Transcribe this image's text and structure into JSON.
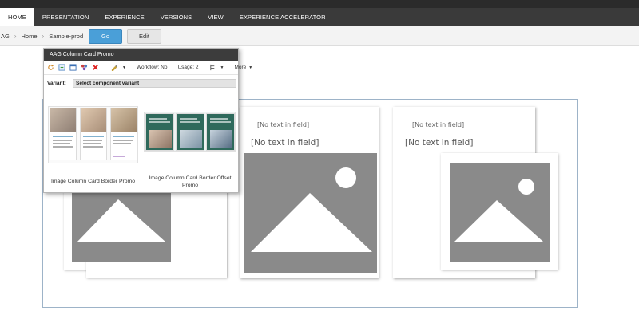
{
  "ribbon": {
    "tabs": [
      {
        "label": "HOME",
        "active": true
      },
      {
        "label": "PRESENTATION"
      },
      {
        "label": "EXPERIENCE"
      },
      {
        "label": "VERSIONS"
      },
      {
        "label": "VIEW"
      },
      {
        "label": "EXPERIENCE ACCELERATOR"
      }
    ]
  },
  "breadcrumb": {
    "items": [
      "AG",
      "Home",
      "Sample-prod"
    ],
    "go_label": "Go",
    "edit_label": "Edit"
  },
  "panel": {
    "title": "AAG Column Card Promo",
    "workflow": "Workflow: No",
    "usage": "Usage: 2",
    "more": "More",
    "variant_label": "Variant:",
    "variant_value": "Select component variant",
    "variants": [
      {
        "caption": "Image Column Card Border Promo"
      },
      {
        "caption": "Image Column Card Border Offset Promo"
      }
    ]
  },
  "stage": {
    "placeholder_small": "[No text in field]",
    "placeholder_large": "[No text in field]"
  },
  "colors": {
    "ribbon_bg": "#3a3a3a",
    "go_button": "#4a9fd8",
    "image_placeholder": "#8a8a8a"
  }
}
